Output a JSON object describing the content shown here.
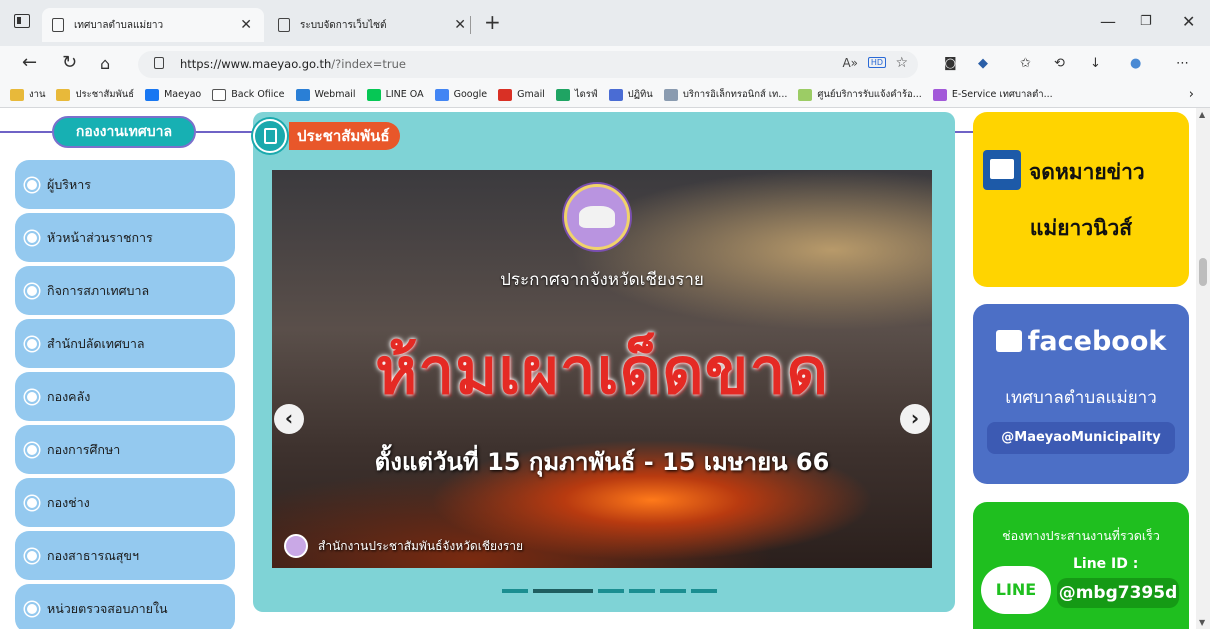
{
  "browser": {
    "tabs": [
      {
        "title": "เทศบาลตำบลแม่ยาว"
      },
      {
        "title": "ระบบจัดการเว็บไซต์"
      }
    ],
    "url": {
      "host": "https://www.maeyao.go.th",
      "path": "/?index=true"
    },
    "bookmarks": [
      {
        "label": "งาน",
        "color": "#e8b93a"
      },
      {
        "label": "ประชาสัมพันธ์",
        "color": "#e8b93a"
      },
      {
        "label": "Maeyao",
        "color": "#1877f2"
      },
      {
        "label": "Back Ofiice",
        "color": "#ffffff"
      },
      {
        "label": "Webmail",
        "color": "#2a7fd6"
      },
      {
        "label": "LINE OA",
        "color": "#06c755"
      },
      {
        "label": "Google",
        "color": "#4285f4"
      },
      {
        "label": "Gmail",
        "color": "#d93025"
      },
      {
        "label": "ไดรฟ์",
        "color": "#1fa463"
      },
      {
        "label": "ปฏิทิน",
        "color": "#4a6cd4"
      },
      {
        "label": "บริการอิเล็กทรอนิกส์ เท...",
        "color": "#8a9bb0"
      },
      {
        "label": "ศูนย์บริการรับแจ้งคำร้อ...",
        "color": "#9ccc65"
      },
      {
        "label": "E-Service เทศบาลตำ...",
        "color": "#a259d9"
      }
    ]
  },
  "sidebar": {
    "heading": "กองงานเทศบาล",
    "items": [
      {
        "label": "ผู้บริหาร"
      },
      {
        "label": "หัวหน้าส่วนราชการ"
      },
      {
        "label": "กิจการสภาเทศบาล"
      },
      {
        "label": "สำนักปลัดเทศบาล"
      },
      {
        "label": "กองคลัง"
      },
      {
        "label": "กองการศึกษา"
      },
      {
        "label": "กองช่าง"
      },
      {
        "label": "กองสาธารณสุขฯ"
      },
      {
        "label": "หน่วยตรวจสอบภายใน"
      }
    ]
  },
  "news": {
    "heading": "ประชาสัมพันธ์",
    "slide": {
      "announcement": "ประกาศจากจังหวัดเชียงราย",
      "headline": "ห้ามเผาเด็ดขาด",
      "date_range": "ตั้งแต่วันที่ 15 กุมภาพันธ์ - 15 เมษายน 66",
      "credit": "สำนักงานประชาสัมพันธ์จังหวัดเชียงราย"
    },
    "prev": "‹",
    "next": "›",
    "slide_count": 6,
    "active_slide": 2
  },
  "right": {
    "newsletter": {
      "line1": "จดหมายข่าว",
      "line2": "แม่ยาวนิวส์"
    },
    "facebook": {
      "brand": "facebook",
      "page_name": "เทศบาลตำบลแม่ยาว",
      "handle": "@MaeyaoMunicipality"
    },
    "line": {
      "caption": "ช่องทางประสานงานที่รวดเร็ว",
      "logo": "LINE",
      "id_label": "Line ID :",
      "id_value": "@mbg7395d"
    }
  },
  "colors": {
    "menu": "#94c9ef",
    "center_panel": "#7fd3d6",
    "sidebar_head": "#17b0b3",
    "accent": "#e8572a"
  }
}
